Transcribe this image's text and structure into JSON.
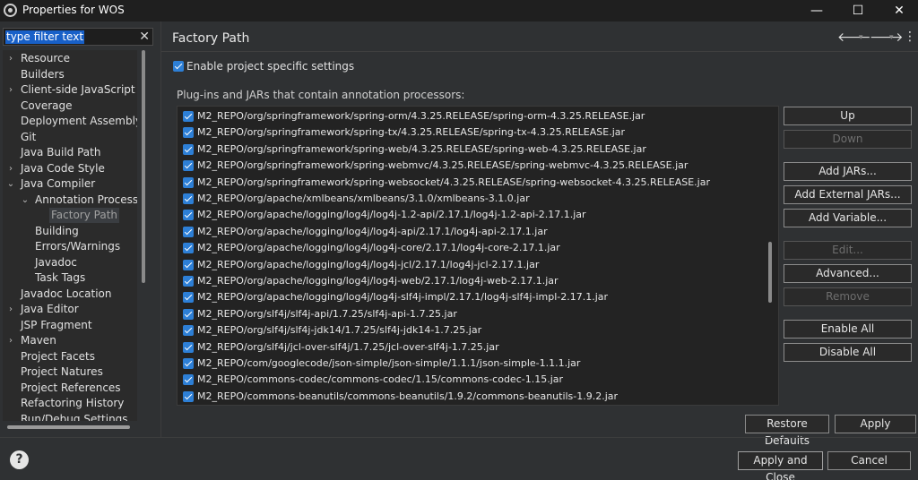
{
  "window": {
    "title": "Properties for WOS",
    "minimize_glyph": "—",
    "maximize_glyph": "☐",
    "close_glyph": "✕"
  },
  "filter": {
    "text": "type filter text",
    "clear_glyph": "✕"
  },
  "tree": [
    {
      "label": "Resource",
      "arrow": "›"
    },
    {
      "label": "Builders",
      "arrow": ""
    },
    {
      "label": "Client-side JavaScript",
      "arrow": "›"
    },
    {
      "label": "Coverage",
      "arrow": ""
    },
    {
      "label": "Deployment Assembly",
      "arrow": ""
    },
    {
      "label": "Git",
      "arrow": ""
    },
    {
      "label": "Java Build Path",
      "arrow": ""
    },
    {
      "label": "Java Code Style",
      "arrow": "›"
    },
    {
      "label": "Java Compiler",
      "arrow": "⌄"
    },
    {
      "label": "Annotation Processin",
      "arrow": "⌄"
    },
    {
      "label": "Factory Path",
      "arrow": ""
    },
    {
      "label": "Building",
      "arrow": ""
    },
    {
      "label": "Errors/Warnings",
      "arrow": ""
    },
    {
      "label": "Javadoc",
      "arrow": ""
    },
    {
      "label": "Task Tags",
      "arrow": ""
    },
    {
      "label": "Javadoc Location",
      "arrow": ""
    },
    {
      "label": "Java Editor",
      "arrow": "›"
    },
    {
      "label": "JSP Fragment",
      "arrow": ""
    },
    {
      "label": "Maven",
      "arrow": "›"
    },
    {
      "label": "Project Facets",
      "arrow": ""
    },
    {
      "label": "Project Natures",
      "arrow": ""
    },
    {
      "label": "Project References",
      "arrow": ""
    },
    {
      "label": "Refactoring History",
      "arrow": ""
    },
    {
      "label": "Run/Debug Settings",
      "arrow": ""
    }
  ],
  "page": {
    "title": "Factory Path",
    "back_glyph": "🡐",
    "forward_glyph": "🡒",
    "menu_glyph": "⋮",
    "enable_label": "Enable project specific settings",
    "section_label": "Plug-ins and JARs that contain annotation processors:"
  },
  "jars": [
    "M2_REPO/org/springframework/spring-orm/4.3.25.RELEASE/spring-orm-4.3.25.RELEASE.jar",
    "M2_REPO/org/springframework/spring-tx/4.3.25.RELEASE/spring-tx-4.3.25.RELEASE.jar",
    "M2_REPO/org/springframework/spring-web/4.3.25.RELEASE/spring-web-4.3.25.RELEASE.jar",
    "M2_REPO/org/springframework/spring-webmvc/4.3.25.RELEASE/spring-webmvc-4.3.25.RELEASE.jar",
    "M2_REPO/org/springframework/spring-websocket/4.3.25.RELEASE/spring-websocket-4.3.25.RELEASE.jar",
    "M2_REPO/org/apache/xmlbeans/xmlbeans/3.1.0/xmlbeans-3.1.0.jar",
    "M2_REPO/org/apache/logging/log4j/log4j-1.2-api/2.17.1/log4j-1.2-api-2.17.1.jar",
    "M2_REPO/org/apache/logging/log4j/log4j-api/2.17.1/log4j-api-2.17.1.jar",
    "M2_REPO/org/apache/logging/log4j/log4j-core/2.17.1/log4j-core-2.17.1.jar",
    "M2_REPO/org/apache/logging/log4j/log4j-jcl/2.17.1/log4j-jcl-2.17.1.jar",
    "M2_REPO/org/apache/logging/log4j/log4j-web/2.17.1/log4j-web-2.17.1.jar",
    "M2_REPO/org/apache/logging/log4j/log4j-slf4j-impl/2.17.1/log4j-slf4j-impl-2.17.1.jar",
    "M2_REPO/org/slf4j/slf4j-api/1.7.25/slf4j-api-1.7.25.jar",
    "M2_REPO/org/slf4j/slf4j-jdk14/1.7.25/slf4j-jdk14-1.7.25.jar",
    "M2_REPO/org/slf4j/jcl-over-slf4j/1.7.25/jcl-over-slf4j-1.7.25.jar",
    "M2_REPO/com/googlecode/json-simple/json-simple/1.1.1/json-simple-1.1.1.jar",
    "M2_REPO/commons-codec/commons-codec/1.15/commons-codec-1.15.jar",
    "M2_REPO/commons-beanutils/commons-beanutils/1.9.2/commons-beanutils-1.9.2.jar"
  ],
  "buttons": {
    "up": "Up",
    "down": "Down",
    "add_jars": "Add JARs...",
    "add_external_jars": "Add External JARs...",
    "add_variable": "Add Variable...",
    "edit": "Edit...",
    "advanced": "Advanced...",
    "remove": "Remove",
    "enable_all": "Enable All",
    "disable_all": "Disable All",
    "restore_defaults": "Restore Defaults",
    "apply": "Apply",
    "apply_and_close": "Apply and Close",
    "cancel": "Cancel",
    "help": "?"
  },
  "colors": {
    "accent": "#2d7fd6",
    "selection": "#1860c8",
    "background": "#2f3133"
  }
}
